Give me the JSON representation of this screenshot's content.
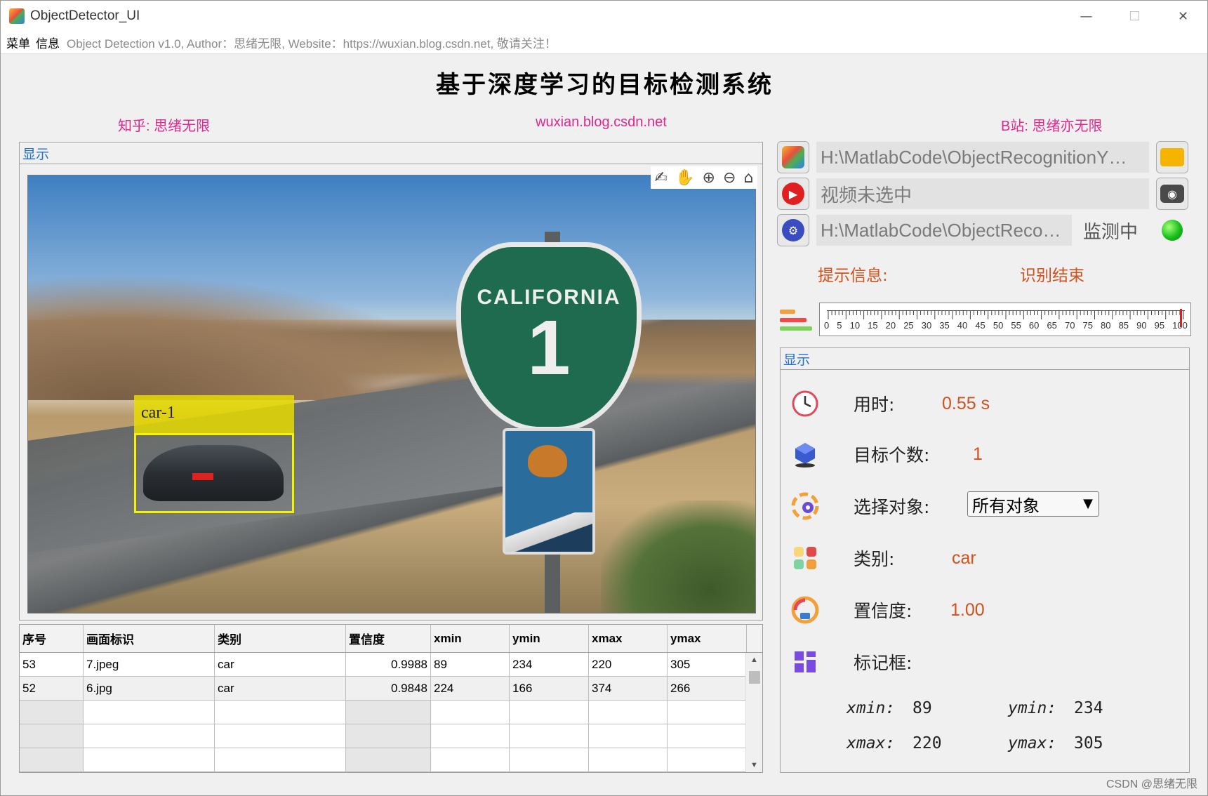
{
  "window": {
    "title": "ObjectDetector_UI",
    "controls": {
      "minimize": "—",
      "maximize": "☐",
      "close": "✕"
    }
  },
  "menubar": {
    "items": [
      "菜单",
      "信息"
    ],
    "info_text": "Object Detection v1.0, Author：思绪无限, Website：https://wuxian.blog.csdn.net, 敬请关注！"
  },
  "header": {
    "title": "基于深度学习的目标检测系统",
    "links": [
      "知乎: 思绪无限",
      "wuxian.blog.csdn.net",
      "B站: 思绪亦无限"
    ],
    "link_color": "#e0288d"
  },
  "display_panel": {
    "title": "显示",
    "image": {
      "sign_top_text": "CALIFORNIA",
      "sign_number": "1"
    },
    "detection": {
      "label": "car-1",
      "box_color": "#f4f400"
    },
    "toolbar_icons": [
      "brush-icon",
      "pan-hand-icon",
      "zoom-in-icon",
      "zoom-out-icon",
      "home-icon"
    ],
    "toolbar_glyphs": [
      "✍",
      "✋",
      "⊕",
      "⊖",
      "⌂"
    ]
  },
  "table": {
    "columns": [
      "序号",
      "画面标识",
      "类别",
      "置信度",
      "xmin",
      "ymin",
      "xmax",
      "ymax"
    ],
    "rows": [
      [
        "53",
        "7.jpeg",
        "car",
        "0.9988",
        "89",
        "234",
        "220",
        "305"
      ],
      [
        "52",
        "6.jpg",
        "car",
        "0.9848",
        "224",
        "166",
        "374",
        "266"
      ]
    ],
    "scroll_up": "▲",
    "scroll_down": "▼"
  },
  "controls": {
    "image_path": "H:\\MatlabCode\\ObjectRecognitionY…",
    "video_path": "视频未选中",
    "model_path": "H:\\MatlabCode\\ObjectReco…",
    "monitor_status": "监测中",
    "status_color": "#17c01a"
  },
  "hint": {
    "label": "提示信息:",
    "value": "识别结束"
  },
  "progress": {
    "ticks": [
      "0",
      "5",
      "10",
      "15",
      "20",
      "25",
      "30",
      "35",
      "40",
      "45",
      "50",
      "55",
      "60",
      "65",
      "70",
      "75",
      "80",
      "85",
      "90",
      "95",
      "100"
    ],
    "value": 100
  },
  "info_panel": {
    "title": "显示",
    "time_label": "用时:",
    "time_value": "0.55 s",
    "count_label": "目标个数:",
    "count_value": "1",
    "select_label": "选择对象:",
    "select_value": "所有对象",
    "class_label": "类别:",
    "class_value": "car",
    "confidence_label": "置信度:",
    "confidence_value": "1.00",
    "bbox_label": "标记框:",
    "xmin_label": "xmin:",
    "xmin_value": "89",
    "ymin_label": "ymin:",
    "ymin_value": "234",
    "xmax_label": "xmax:",
    "xmax_value": "220",
    "ymax_label": "ymax:",
    "ymax_value": "305",
    "value_color": "#d2511c"
  },
  "watermark": "CSDN @思绪无限"
}
